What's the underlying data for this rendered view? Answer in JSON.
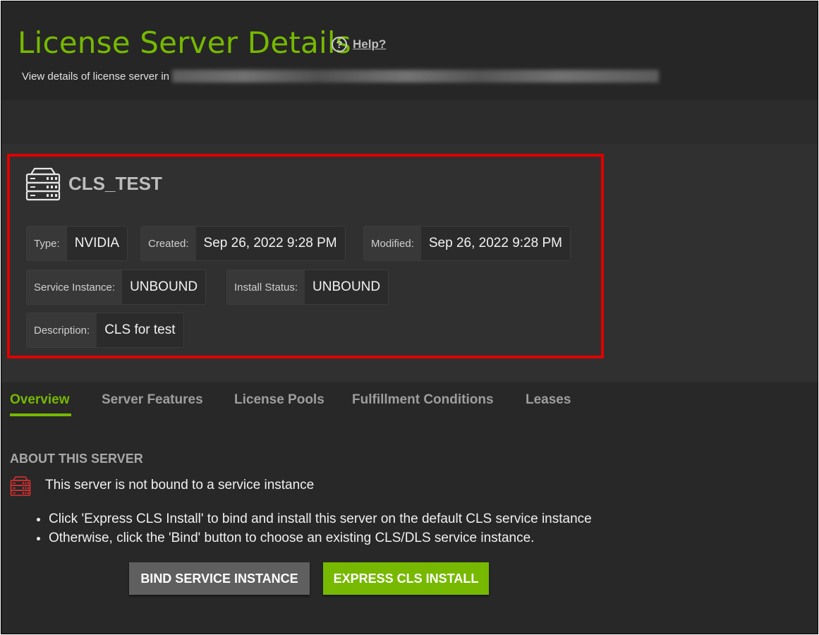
{
  "header": {
    "title": "License Server Details",
    "help_label": "Help?",
    "subtitle": "View details of license server in"
  },
  "server": {
    "name": "CLS_TEST",
    "fields": {
      "type_label": "Type:",
      "type_value": "NVIDIA",
      "created_label": "Created:",
      "created_value": "Sep 26, 2022 9:28 PM",
      "modified_label": "Modified:",
      "modified_value": "Sep 26, 2022 9:28 PM",
      "service_instance_label": "Service Instance:",
      "service_instance_value": "UNBOUND",
      "install_status_label": "Install Status:",
      "install_status_value": "UNBOUND",
      "description_label": "Description:",
      "description_value": "CLS for test"
    }
  },
  "tabs": [
    {
      "label": "Overview",
      "active": true
    },
    {
      "label": "Server Features",
      "active": false
    },
    {
      "label": "License Pools",
      "active": false
    },
    {
      "label": "Fulfillment Conditions",
      "active": false
    },
    {
      "label": "Leases",
      "active": false
    }
  ],
  "overview": {
    "section_title": "ABOUT THIS SERVER",
    "status_message": "This server is not bound to a service instance",
    "bullets": [
      "Click 'Express CLS Install' to bind and install this server on the default CLS service instance",
      "Otherwise, click the 'Bind' button to choose an existing CLS/DLS service instance."
    ],
    "bind_button": "BIND SERVICE INSTANCE",
    "express_button": "EXPRESS CLS INSTALL"
  },
  "colors": {
    "accent": "#76b900",
    "highlight_border": "#e00000",
    "warning_icon": "#e03030"
  },
  "icons": {
    "server": "server-rack-icon",
    "help": "help-circle-icon",
    "warning_server": "server-warning-icon"
  }
}
